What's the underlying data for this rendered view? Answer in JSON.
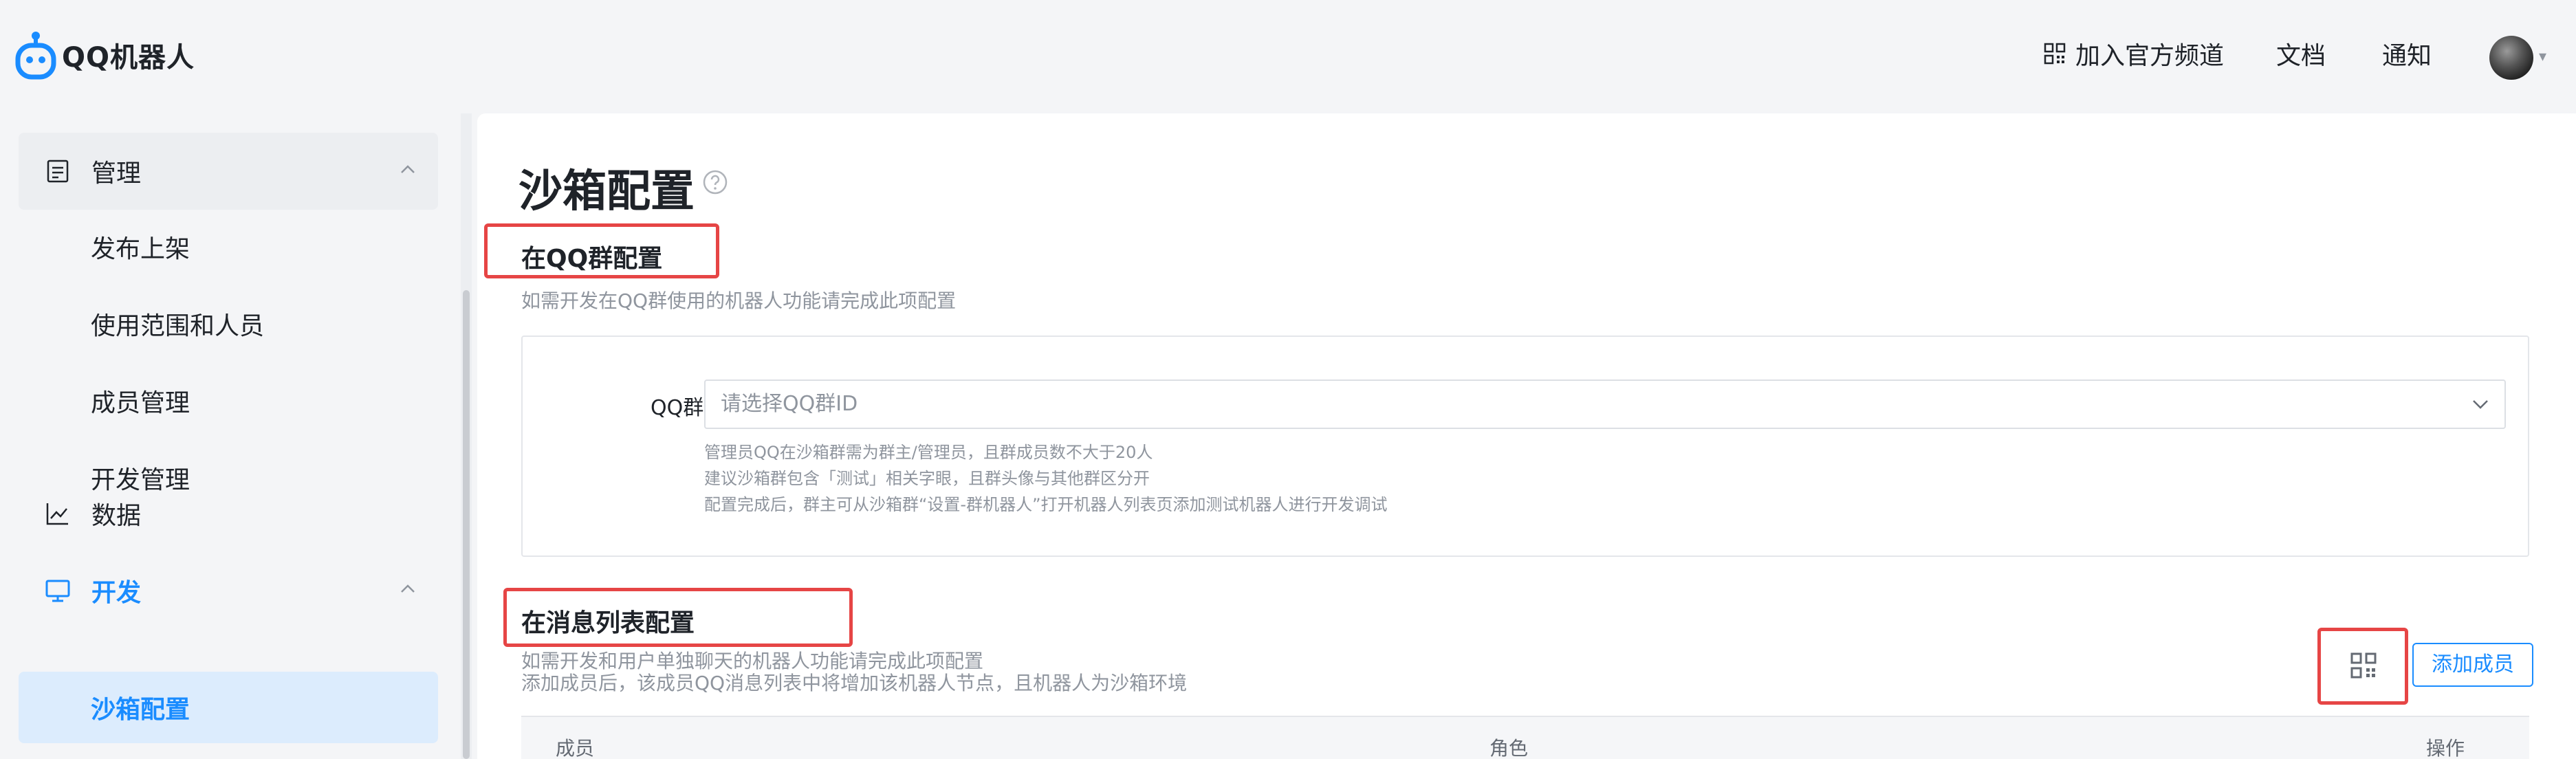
{
  "header": {
    "logo_text": "QQ机器人",
    "nav_join": "加入官方频道",
    "nav_docs": "文档",
    "nav_notify": "通知"
  },
  "sidebar": {
    "group_manage": "管理",
    "items_manage": [
      "发布上架",
      "使用范围和人员",
      "成员管理",
      "开发管理"
    ],
    "group_data": "数据",
    "group_dev": "开发",
    "active_item": "沙箱配置"
  },
  "main": {
    "page_title": "沙箱配置",
    "group_section": {
      "title": "在QQ群配置",
      "desc": "如需开发在QQ群使用的机器人功能请完成此项配置",
      "field_label": "QQ群ID",
      "select_placeholder": "请选择QQ群ID",
      "hints": [
        "管理员QQ在沙箱群需为群主/管理员，且群成员数不大于20人",
        "建议沙箱群包含「测试」相关字眼，且群头像与其他群区分开",
        "配置完成后，群主可从沙箱群“设置-群机器人”打开机器人列表页添加测试机器人进行开发调试"
      ]
    },
    "msg_section": {
      "title": "在消息列表配置",
      "desc_lines": [
        "如需开发和用户单独聊天的机器人功能请完成此项配置",
        "添加成员后，该成员QQ消息列表中将增加该机器人节点，且机器人为沙箱环境"
      ],
      "add_button": "添加成员",
      "table_headers": [
        "成员",
        "角色",
        "操作"
      ]
    }
  },
  "colors": {
    "accent": "#1a8cff",
    "highlight_box": "#e64545",
    "active_bg": "#dcecfd"
  }
}
